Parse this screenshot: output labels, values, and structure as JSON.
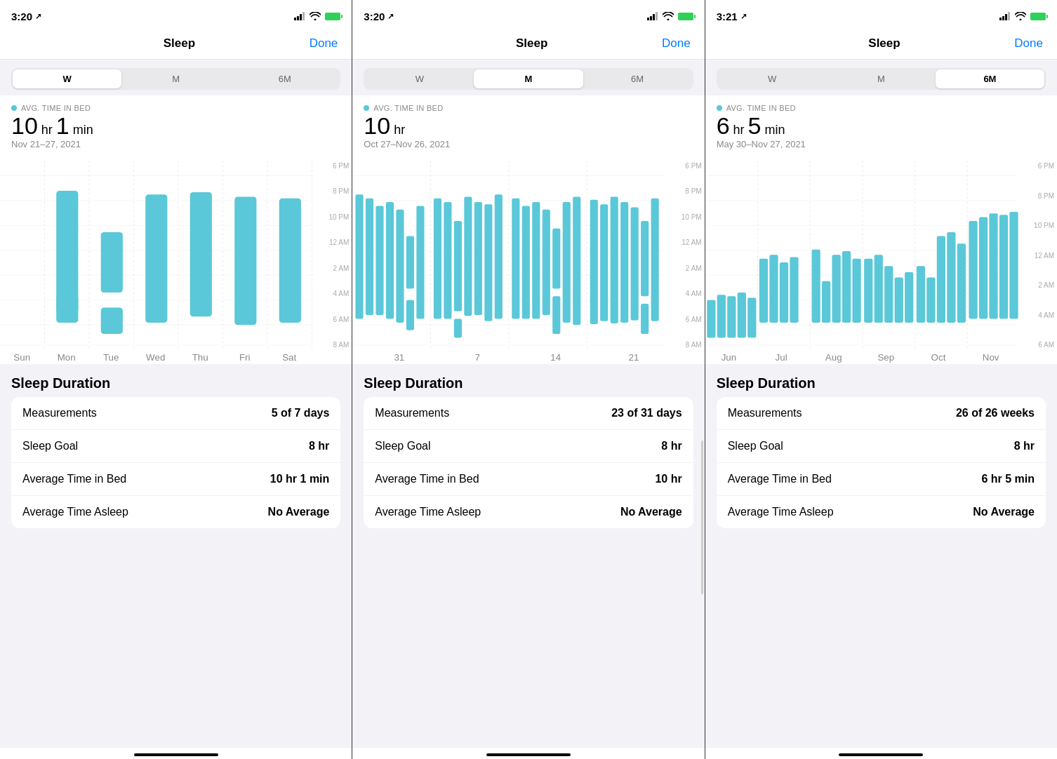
{
  "screens": [
    {
      "id": "screen-week",
      "statusBar": {
        "time": "3:20",
        "arrow": "↗"
      },
      "nav": {
        "title": "Sleep",
        "done": "Done"
      },
      "segments": {
        "options": [
          "W",
          "M",
          "6M"
        ],
        "active": 0
      },
      "avgLabel": "AVG. TIME IN BED",
      "avgValue": "10",
      "avgUnit1": "hr",
      "avgSub": "1",
      "avgUnit2": "min",
      "avgDate": "Nov 21–27, 2021",
      "chartType": "week",
      "sleepDuration": {
        "title": "Sleep Duration",
        "rows": [
          {
            "label": "Measurements",
            "value": "5 of 7 days"
          },
          {
            "label": "Sleep Goal",
            "value": "8 hr"
          },
          {
            "label": "Average Time in Bed",
            "value": "10 hr 1 min"
          },
          {
            "label": "Average Time Asleep",
            "value": "No Average"
          }
        ]
      }
    },
    {
      "id": "screen-month",
      "statusBar": {
        "time": "3:20",
        "arrow": "↗"
      },
      "nav": {
        "title": "Sleep",
        "done": "Done"
      },
      "segments": {
        "options": [
          "W",
          "M",
          "6M"
        ],
        "active": 1
      },
      "avgLabel": "AVG. TIME IN BED",
      "avgValue": "10",
      "avgUnit1": "hr",
      "avgSub": "",
      "avgUnit2": "",
      "avgDate": "Oct 27–Nov 26, 2021",
      "chartType": "month",
      "sleepDuration": {
        "title": "Sleep Duration",
        "rows": [
          {
            "label": "Measurements",
            "value": "23 of 31 days"
          },
          {
            "label": "Sleep Goal",
            "value": "8 hr"
          },
          {
            "label": "Average Time in Bed",
            "value": "10 hr"
          },
          {
            "label": "Average Time Asleep",
            "value": "No Average"
          }
        ]
      }
    },
    {
      "id": "screen-6m",
      "statusBar": {
        "time": "3:21",
        "arrow": "↗"
      },
      "nav": {
        "title": "Sleep",
        "done": "Done"
      },
      "segments": {
        "options": [
          "W",
          "M",
          "6M"
        ],
        "active": 2
      },
      "avgLabel": "AVG. TIME IN BED",
      "avgValue": "6",
      "avgUnit1": "hr",
      "avgSub": "5",
      "avgUnit2": "min",
      "avgDate": "May 30–Nov 27, 2021",
      "chartType": "6m",
      "sleepDuration": {
        "title": "Sleep Duration",
        "rows": [
          {
            "label": "Measurements",
            "value": "26 of 26 weeks"
          },
          {
            "label": "Sleep Goal",
            "value": "8 hr"
          },
          {
            "label": "Average Time in Bed",
            "value": "6 hr 5 min"
          },
          {
            "label": "Average Time Asleep",
            "value": "No Average"
          }
        ]
      }
    }
  ],
  "yAxisLabels": [
    "6 PM",
    "8 PM",
    "10 PM",
    "12 AM",
    "2 AM",
    "4 AM",
    "6 AM",
    "8 AM"
  ],
  "weekXLabels": [
    "Sun",
    "Mon",
    "Tue",
    "Wed",
    "Thu",
    "Fri",
    "Sat"
  ],
  "monthXLabels": [
    "31",
    "7",
    "14",
    "21"
  ],
  "sixMonthXLabels": [
    "Jun",
    "Jul",
    "Aug",
    "Sep",
    "Oct",
    "Nov"
  ]
}
